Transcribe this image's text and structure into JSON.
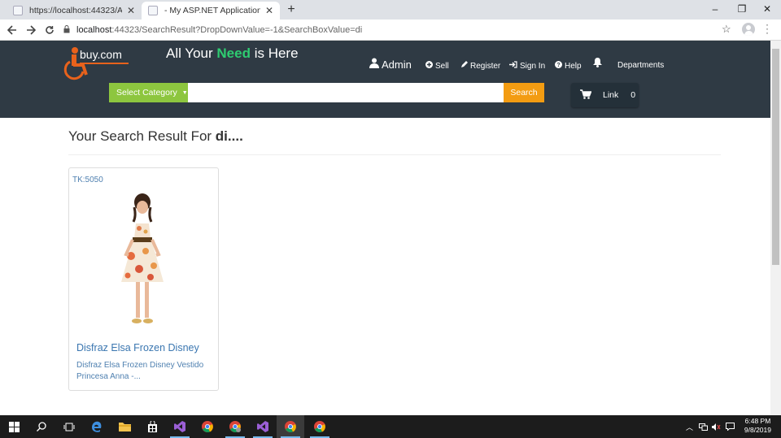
{
  "browser": {
    "tabs": [
      {
        "title": "https://localhost:44323/Admin/P",
        "close": "✕"
      },
      {
        "title": "- My ASP.NET Application",
        "close": "✕"
      }
    ],
    "new_tab": "+",
    "window_controls": {
      "minimize": "–",
      "restore": "❐",
      "close": "✕"
    },
    "url_host": "localhost",
    "url_path": ":44323/SearchResult?DropDownValue=-1&SearchBoxValue=di",
    "icons": [
      "back-icon",
      "forward-icon",
      "reload-icon",
      "lock-icon",
      "star-icon",
      "profile-icon",
      "menu-icon"
    ]
  },
  "header": {
    "logo_text": "buy.com",
    "tagline_pre": "All Your ",
    "tagline_need": "Need",
    "tagline_post": " is Here",
    "nav": {
      "admin": "Admin",
      "sell": "Sell",
      "register": "Register",
      "signin": "Sign In",
      "help": "Help",
      "departments": "Departments"
    },
    "category_label": "Select Category",
    "search_value": "",
    "search_button": "Search",
    "cart_label": "Link",
    "cart_count": "0",
    "colors": {
      "header_bg": "#2f3a44",
      "need_green": "#2ecc71",
      "category_green": "#8dc63f",
      "search_orange": "#f39c12",
      "logo_orange": "#e8621c"
    }
  },
  "main": {
    "heading_pre": "Your Search Result For ",
    "heading_term": "di....",
    "products": [
      {
        "price": "TK:5050",
        "name": "Disfraz Elsa Frozen Disney",
        "description": "Disfraz Elsa Frozen Disney Vestido Princesa Anna -..."
      }
    ]
  },
  "taskbar": {
    "time": "6:48 PM",
    "date": "9/8/2019"
  }
}
